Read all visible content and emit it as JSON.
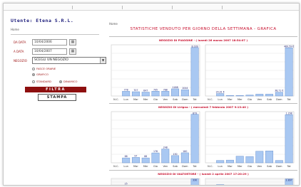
{
  "left_panel": {
    "user_label": "Utente: Etena S.R.L.",
    "home_link": "Home",
    "da_data_label": "DA DATA",
    "da_data_value": "10/04/2006",
    "a_data_label": "A DATA",
    "a_data_value": "10/04/2007",
    "negozio_label": "NEGOZIO",
    "negozio_value": "SCEGLI UN NEGOZIO",
    "radio_tabella": "FASCE ORARIE",
    "radio_grafico": "GRAFICO",
    "radio_standard": "STANDARD",
    "radio_dinamico": "DINAMICO",
    "filtra_label": "FILTRA",
    "stampa_label": "STAMPA"
  },
  "header": {
    "home_link": "Home",
    "title": "STATISTICHE VENDUTO PER GIORNO DELLA SETTIMANA - GRAFICA"
  },
  "sections": [
    {
      "title": "NEGOZIO DI PIAGGINE - ( lunedì 26 marzo 2007 18:54:07 )"
    },
    {
      "title": "NEGOZIO DI Lirigno - ( mercoledì 7 febbraio 2007 9:13:40 )"
    },
    {
      "title": "NEGOZIO DI VALTORTORE - ( lunedì 2 aprile 2007 17:20:29 )"
    }
  ],
  "chart_data": [
    {
      "type": "bar",
      "title": "Piaggine - quantità",
      "categories": [
        "N.C.",
        "Lun",
        "Mar",
        "Mer",
        "Gio",
        "Ven",
        "Sab",
        "Dom",
        "Tot"
      ],
      "values": [
        0,
        778,
        707,
        647,
        795,
        788,
        1188,
        1044,
        8039
      ],
      "ylim": [
        0,
        8500
      ],
      "value_labels": [
        "",
        "778",
        "707",
        "647",
        "795",
        "788",
        "1188",
        "1044",
        "8.039"
      ]
    },
    {
      "type": "bar",
      "title": "Piaggine - valore",
      "categories": [
        "N.C.",
        "Lun",
        "Mar",
        "Mer",
        "Gio",
        "Ven",
        "Sab",
        "Dom",
        "Tot"
      ],
      "values": [
        0,
        24.91,
        5.5,
        5.5,
        9.8,
        18.6,
        18.6,
        38.71,
        489.59
      ],
      "ylim": [
        0,
        520
      ],
      "value_labels": [
        "",
        "24,91 €",
        "",
        "",
        "",
        "",
        "",
        "38,71 €",
        "489,59 €"
      ]
    },
    {
      "type": "bar",
      "title": "Lirigno - quantità",
      "categories": [
        "N.C.",
        "Lun",
        "Mar",
        "Mer",
        "Gio",
        "Ven",
        "Sab",
        "Dom",
        "Tot"
      ],
      "values": [
        0,
        88,
        97,
        88,
        178,
        248,
        130,
        180,
        873
      ],
      "ylim": [
        0,
        920
      ],
      "value_labels": [
        "",
        "88",
        "97",
        "88",
        "178",
        "248",
        "130",
        "180",
        "873"
      ]
    },
    {
      "type": "bar",
      "title": "Lirigno - valore",
      "categories": [
        "N.C.",
        "Lun",
        "Mar",
        "Mer",
        "Gio",
        "Ven",
        "Sab",
        "Dom",
        "Tot"
      ],
      "values": [
        0,
        64.1,
        73.4,
        178.9,
        170.6,
        312.4,
        321.8,
        64.0,
        1298.3
      ],
      "ylim": [
        0,
        1380
      ],
      "value_labels": [
        "",
        "",
        "",
        "",
        "",
        "",
        "",
        "",
        "1.298"
      ]
    },
    {
      "type": "bar",
      "title": "Valtortore - quantità",
      "categories": [
        "N.C.",
        "Lun",
        "Mar",
        "Mer",
        "Gio",
        "Ven",
        "Sab",
        "Dom",
        "Tot"
      ],
      "values": [
        0,
        25,
        0,
        0,
        0,
        0,
        0,
        0,
        330
      ],
      "ylim": [
        0,
        350
      ],
      "value_labels": [
        "",
        "25",
        "",
        "",
        "",
        "",
        "",
        "",
        "330"
      ]
    },
    {
      "type": "bar",
      "title": "Valtortore - valore",
      "categories": [
        "N.C.",
        "Lun",
        "Mar",
        "Mer",
        "Gio",
        "Ven",
        "Sab",
        "Dom",
        "Tot"
      ],
      "values": [
        0,
        41,
        0,
        0,
        0,
        0,
        0,
        0,
        280
      ],
      "ylim": [
        0,
        300
      ],
      "value_labels": [
        "",
        "",
        "",
        "",
        "",
        "",
        "",
        "",
        "2.897"
      ]
    }
  ],
  "colors": {
    "bar": "#a9c8f2",
    "bar_stroke": "#6f95cf",
    "title_red": "#c8102e",
    "button": "#8e0f0f"
  }
}
